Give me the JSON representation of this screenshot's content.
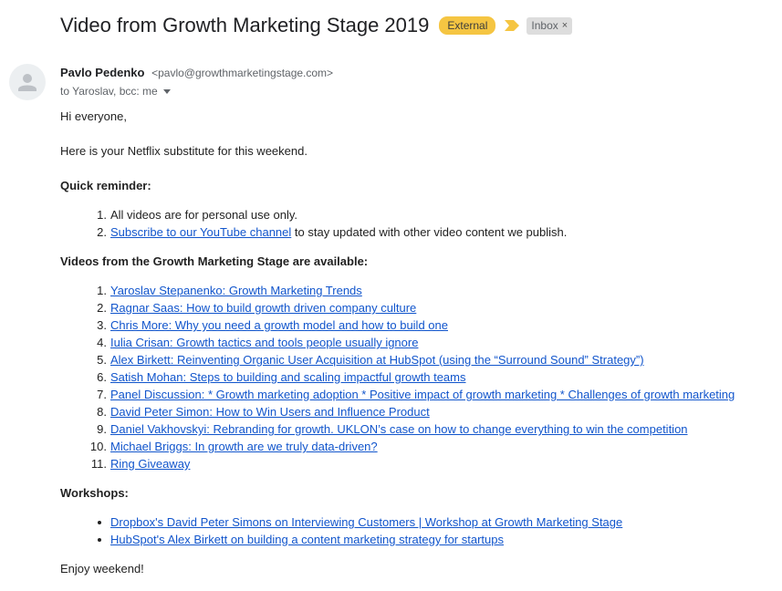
{
  "header": {
    "subject": "Video from Growth Marketing Stage 2019",
    "external_badge": "External",
    "inbox_label": "Inbox",
    "inbox_remove": "×"
  },
  "sender": {
    "name": "Pavlo Pedenko",
    "email": "<pavlo@growthmarketingstage.com>",
    "recipients": "to Yaroslav, bcc: me"
  },
  "body": {
    "greeting": "Hi everyone,",
    "intro": "Here is your Netflix substitute for this weekend.",
    "reminder_heading": "Quick reminder:",
    "reminder_items": [
      {
        "num": "1.",
        "text": "All videos are for personal use only."
      },
      {
        "num": "2.",
        "link": "Subscribe to our YouTube channel",
        "suffix": " to stay updated with other video content we publish."
      }
    ],
    "videos_heading": "Videos from the Growth Marketing Stage are available:",
    "videos": [
      {
        "num": "1.",
        "title": "Yaroslav Stepanenko: Growth Marketing Trends"
      },
      {
        "num": "2.",
        "title": "Ragnar Saas: How to build growth driven company culture"
      },
      {
        "num": "3.",
        "title": "Chris More: Why you need a growth model and how to build one"
      },
      {
        "num": "4.",
        "title": "Iulia Crisan: Growth tactics and tools people usually ignore"
      },
      {
        "num": "5.",
        "title": "Alex Birkett: Reinventing Organic User Acquisition at HubSpot (using the “Surround Sound” Strategy”)"
      },
      {
        "num": "6.",
        "title": "Satish Mohan: Steps to building and scaling impactful growth teams"
      },
      {
        "num": "7.",
        "title": "Panel Discussion: * Growth marketing adoption * Positive impact of growth marketing * Challenges of growth marketing"
      },
      {
        "num": "8.",
        "title": "David Peter Simon: How to Win Users and Influence Product"
      },
      {
        "num": "9.",
        "title": "Daniel Vakhovskyi: Rebranding for growth. UKLON’s case on how to change everything to win the competition"
      },
      {
        "num": "10.",
        "title": "Michael Briggs: In growth are we truly data-driven?"
      },
      {
        "num": "11.",
        "title": "Ring Giveaway"
      }
    ],
    "workshops_heading": "Workshops:",
    "workshops": [
      "Dropbox's David Peter Simons on Interviewing Customers | Workshop at Growth Marketing Stage",
      "HubSpot's Alex Birkett on building a content marketing strategy for startups"
    ],
    "closing": "Enjoy weekend!"
  },
  "colors": {
    "link": "#1155cc",
    "external_badge": "#f5c542",
    "importance_marker": "#f5c542",
    "inbox_label_bg": "#dddddd"
  },
  "icons": {
    "avatar": "person-icon",
    "importance": "importance-marker-icon",
    "recipients_toggle": "chevron-down-icon"
  }
}
